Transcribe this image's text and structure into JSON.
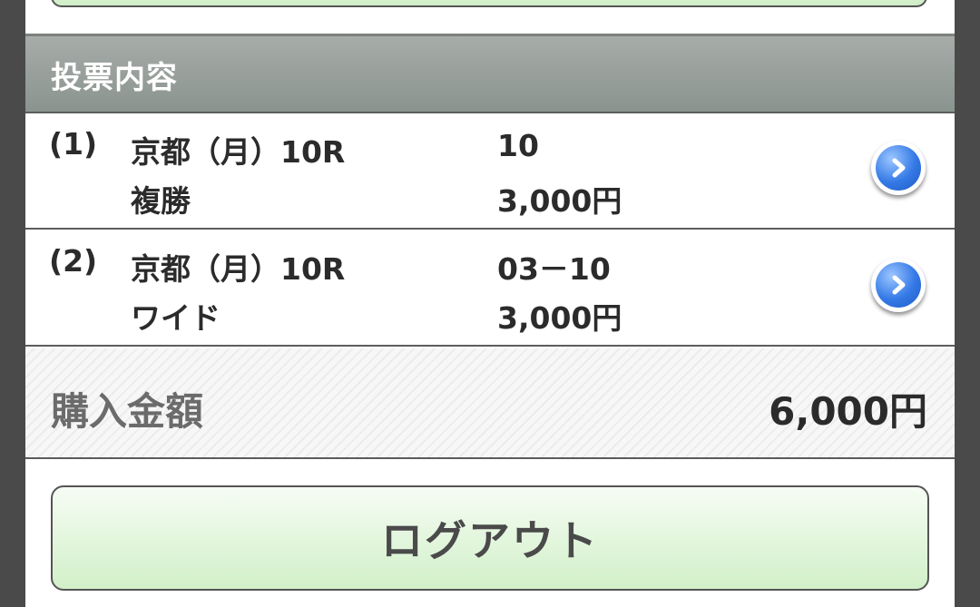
{
  "section": {
    "title": "投票内容"
  },
  "bets": [
    {
      "number": "(1)",
      "race": "京都（月）10R",
      "bet_type": "複勝",
      "selection": "10",
      "amount": "3,000円",
      "chevron_icon": "chevron-right-icon"
    },
    {
      "number": "(2)",
      "race": "京都（月）10R",
      "bet_type": "ワイド",
      "selection": "03－10",
      "amount": "3,000円",
      "chevron_icon": "chevron-right-icon"
    }
  ],
  "total": {
    "label": "購入金額",
    "value": "6,000円"
  },
  "logout": {
    "label": "ログアウト"
  },
  "colors": {
    "header_bg": "#8e9893",
    "button_green": "#cfeec6",
    "chevron_blue": "#3479e6"
  }
}
